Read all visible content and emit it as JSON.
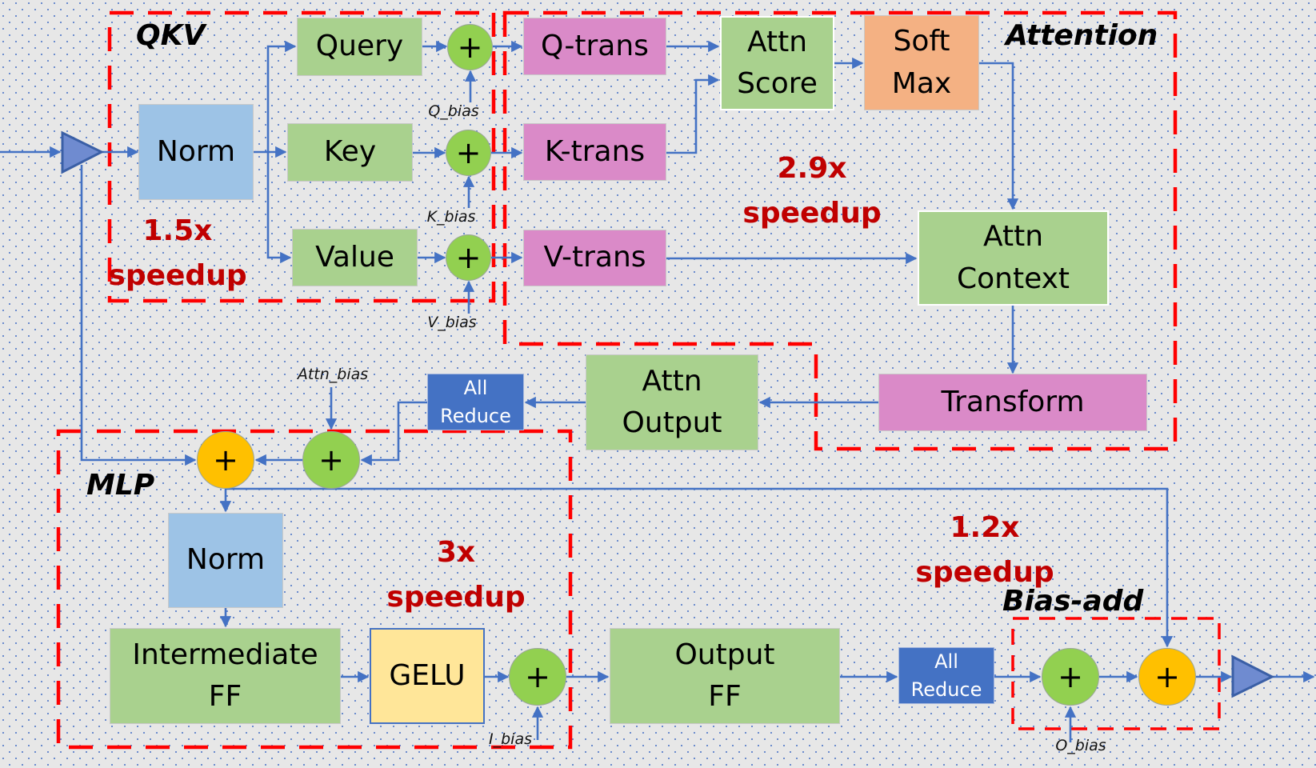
{
  "colors": {
    "background": "#e7e7e7",
    "wire": "#4472c4",
    "dashed_region": "#ff0000",
    "speedup_text": "#c00000",
    "block_green": "#a9d18e",
    "block_norm_blue": "#9dc3e6",
    "block_pink": "#da8ac8",
    "block_orange": "#f4b183",
    "block_yellow": "#ffe699",
    "block_allreduce": "#4472c4",
    "adder_green": "#92d050",
    "adder_orange": "#ffc000"
  },
  "regions": {
    "qkv": {
      "label": "QKV",
      "speedup": "1.5x\nspeedup"
    },
    "attention": {
      "label": "Attention",
      "speedup": "2.9x\nspeedup"
    },
    "mlp": {
      "label": "MLP",
      "speedup": "3x\nspeedup"
    },
    "bias_add": {
      "label": "Bias-add",
      "speedup": "1.2x\nspeedup"
    }
  },
  "blocks": {
    "qkv_norm": "Norm",
    "query": "Query",
    "key": "Key",
    "value": "Value",
    "q_trans": "Q-trans",
    "k_trans": "K-trans",
    "v_trans": "V-trans",
    "attn_score": "Attn\nScore",
    "soft_max": "Soft\nMax",
    "attn_context": "Attn\nContext",
    "transform": "Transform",
    "attn_output": "Attn\nOutput",
    "all_reduce_top": "All\nReduce",
    "mlp_norm": "Norm",
    "intermediate_ff": "Intermediate\nFF",
    "gelu": "GELU",
    "output_ff": "Output\nFF",
    "all_reduce_bottom": "All\nReduce"
  },
  "adders": {
    "symbol": "+"
  },
  "bias_labels": {
    "q_bias": "Q_bias",
    "k_bias": "K_bias",
    "v_bias": "V_bias",
    "attn_bias": "Attn_bias",
    "i_bias": "I_bias",
    "o_bias": "O_bias"
  }
}
